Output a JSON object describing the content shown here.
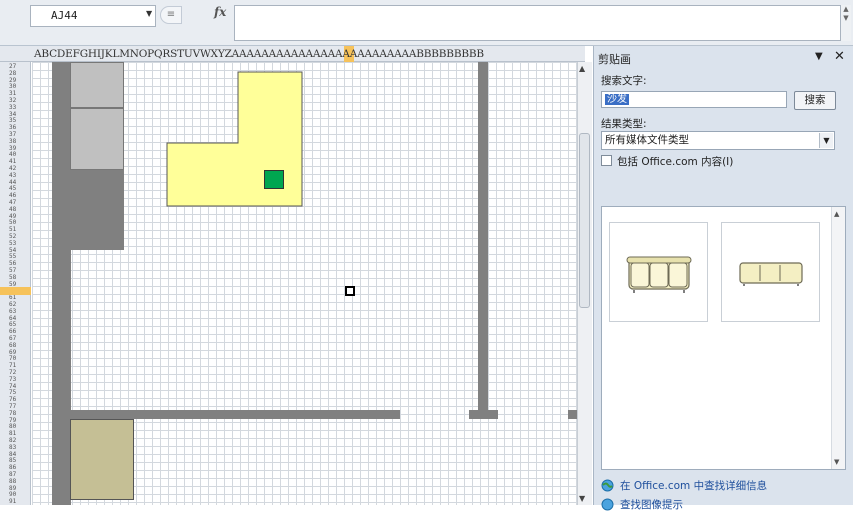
{
  "formula_bar": {
    "name_box": "AJ44",
    "fx_label": "fx"
  },
  "sheet": {
    "column_headers": "ABCDEFGHIJKLMNOPQRSTUVWXYZAAAAAAAAAAAAAAAAAAAAAAAAABBBBBBBBB",
    "row_numbers": [
      "27",
      "28",
      "29",
      "30",
      "31",
      "32",
      "33",
      "34",
      "35",
      "36",
      "37",
      "38",
      "39",
      "40",
      "41",
      "42",
      "43",
      "44",
      "45",
      "46",
      "47",
      "48",
      "49",
      "50",
      "51",
      "52",
      "53",
      "54",
      "55",
      "56",
      "57",
      "58",
      "59",
      "60",
      "61",
      "62",
      "63",
      "64",
      "65",
      "66",
      "67",
      "68",
      "69",
      "70",
      "71",
      "72",
      "73",
      "74",
      "75",
      "76",
      "77",
      "78",
      "79",
      "80",
      "81",
      "82",
      "83",
      "84",
      "85",
      "86",
      "87",
      "88",
      "89",
      "90",
      "91"
    ],
    "selected_row": "44",
    "selected_column": "A",
    "colors": {
      "wall": "#808080",
      "light_block": "#c0c0c0",
      "yellow_room": "#ffff99",
      "green_marker": "#00a650",
      "tan_block": "#c5bf95",
      "selection": "#f6c25a"
    }
  },
  "clip_art_pane": {
    "title": "剪贴画",
    "menu_arrow": "▼",
    "close": "✕",
    "search_label": "搜索文字:",
    "search_value": "沙发",
    "search_button": "搜索",
    "results_type_label": "结果类型:",
    "results_type_value": "所有媒体文件类型",
    "include_office_label": "包括 Office.com 内容(I)",
    "include_office_checked": false,
    "results": [
      {
        "name": "sofa-clipart-1"
      },
      {
        "name": "sofa-clipart-2"
      }
    ],
    "more_link": "在 Office.com 中查找详细信息",
    "tips_link": "查找图像提示"
  }
}
